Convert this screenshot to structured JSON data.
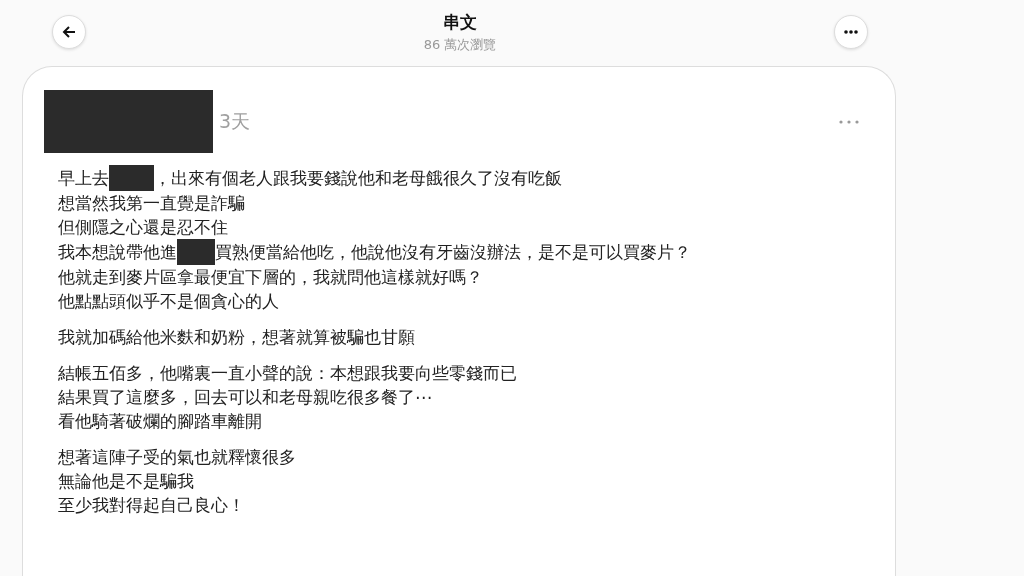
{
  "header": {
    "title": "串文",
    "views": "86 萬次瀏覽"
  },
  "post": {
    "author": {
      "kind": "redacted"
    },
    "time": "3天",
    "paragraphs": [
      {
        "lines": [
          {
            "parts": [
              {
                "kind": "text",
                "text": "早上去"
              },
              {
                "kind": "redacted"
              },
              {
                "kind": "text",
                "text": "，出來有個老人跟我要錢說他和老母餓很久了沒有吃飯"
              }
            ]
          },
          {
            "parts": [
              {
                "kind": "text",
                "text": "想當然我第一直覺是詐騙"
              }
            ]
          },
          {
            "parts": [
              {
                "kind": "text",
                "text": "但側隱之心還是忍不住"
              }
            ]
          },
          {
            "parts": [
              {
                "kind": "text",
                "text": "我本想說帶他進"
              },
              {
                "kind": "redacted"
              },
              {
                "kind": "text",
                "text": "買熟便當給他吃，他說他沒有牙齒沒辦法，是不是可以買麥片？"
              }
            ]
          },
          {
            "parts": [
              {
                "kind": "text",
                "text": "他就走到麥片區拿最便宜下層的，我就問他這樣就好嗎？"
              }
            ]
          },
          {
            "parts": [
              {
                "kind": "text",
                "text": "他點點頭似乎不是個貪心的人"
              }
            ]
          }
        ]
      },
      {
        "lines": [
          {
            "parts": [
              {
                "kind": "text",
                "text": "我就加碼給他米麩和奶粉，想著就算被騙也甘願"
              }
            ]
          }
        ]
      },
      {
        "lines": [
          {
            "parts": [
              {
                "kind": "text",
                "text": "結帳五佰多，他嘴裏一直小聲的說：本想跟我要向些零錢而已"
              }
            ]
          },
          {
            "parts": [
              {
                "kind": "text",
                "text": "結果買了這麼多，回去可以和老母親吃很多餐了⋯"
              }
            ]
          },
          {
            "parts": [
              {
                "kind": "text",
                "text": "看他騎著破爛的腳踏車離開"
              }
            ]
          }
        ]
      },
      {
        "lines": [
          {
            "parts": [
              {
                "kind": "text",
                "text": "想著這陣子受的氣也就釋懷很多"
              }
            ]
          },
          {
            "parts": [
              {
                "kind": "text",
                "text": "無論他是不是騙我"
              }
            ]
          },
          {
            "parts": [
              {
                "kind": "text",
                "text": "至少我對得起自己良心！"
              }
            ]
          }
        ]
      }
    ]
  }
}
